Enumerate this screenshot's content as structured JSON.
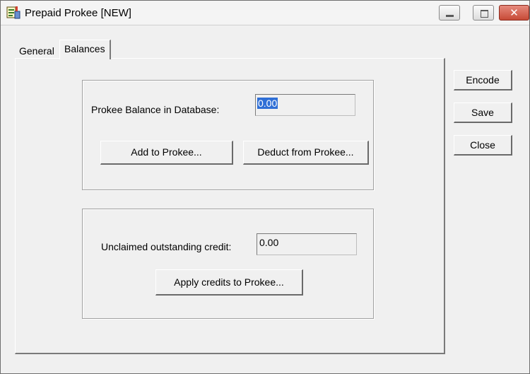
{
  "window": {
    "title": "Prepaid Prokee  [NEW]",
    "controls": {
      "minimize_icon": "minimize-icon",
      "maximize_icon": "maximize-icon",
      "close_glyph": "✕"
    },
    "colors": {
      "close_button": "#c74a36",
      "selection": "#2f6fd6"
    }
  },
  "tabs": [
    {
      "label": "General",
      "active": false
    },
    {
      "label": "Balances",
      "active": true
    }
  ],
  "database_group": {
    "balance_label": "Prokee Balance in Database:",
    "balance_value": "0.00",
    "add_button": "Add to Prokee...",
    "deduct_button": "Deduct from Prokee..."
  },
  "credit_group": {
    "unclaimed_label": "Unclaimed outstanding credit:",
    "unclaimed_value": "0.00",
    "apply_button": "Apply credits to Prokee..."
  },
  "side_buttons": {
    "encode": "Encode",
    "save": "Save",
    "close": "Close"
  }
}
